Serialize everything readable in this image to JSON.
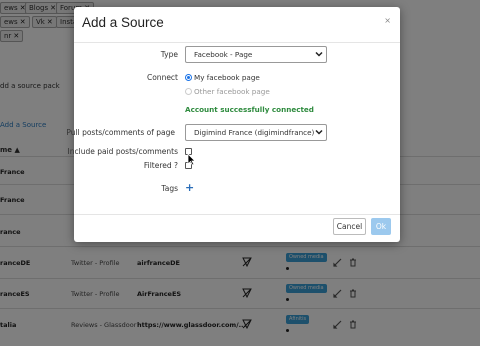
{
  "background": {
    "tags": [
      {
        "label": "ews",
        "x": 0,
        "y": 2
      },
      {
        "label": "Blogs",
        "x": 25,
        "y": 2
      },
      {
        "label": "Forum",
        "x": 56,
        "y": 2
      },
      {
        "label": "ews",
        "x": 0,
        "y": 16
      },
      {
        "label": "Vk",
        "x": 32,
        "y": 16
      },
      {
        "label": "Insta",
        "x": 56,
        "y": 16
      },
      {
        "label": "nr",
        "x": 0,
        "y": 30
      }
    ],
    "add_source_pack": "dd a source pack",
    "add_source_link": "Add a Source",
    "name_header": "me",
    "rows": [
      {
        "name": "France",
        "type": "",
        "handle": "",
        "badge": ""
      },
      {
        "name": "France",
        "type": "",
        "handle": "",
        "badge": ""
      },
      {
        "name": "rance",
        "type": "",
        "handle": "",
        "badge": ""
      },
      {
        "name": "ranceDE",
        "type": "Twitter - Profile",
        "handle": "airfranceDE",
        "badge": "Owned media"
      },
      {
        "name": "ranceES",
        "type": "Twitter - Profile",
        "handle": "AirFranceES",
        "badge": "Owned media"
      },
      {
        "name": "talia",
        "type": "Reviews - Glassdoor",
        "handle": "https://www.glassdoor.com/...",
        "badge": "Afinitis"
      }
    ]
  },
  "modal": {
    "title": "Add a Source",
    "close_label": "×",
    "type_label": "Type",
    "type_value": "Facebook - Page",
    "connect_label": "Connect",
    "connect_options": [
      {
        "label": "My facebook page",
        "selected": true
      },
      {
        "label": "Other facebook page",
        "selected": false
      }
    ],
    "success_message": "Account successfully connected",
    "pull_label": "Pull posts/comments of page",
    "pull_value": "Digimind France (digimindfrance)",
    "paid_label": "Include paid posts/comments",
    "filtered_label": "Filtered ?",
    "tags_label": "Tags",
    "cancel_label": "Cancel",
    "ok_label": "Ok"
  },
  "colors": {
    "accent": "#1a73e8",
    "success": "#2e8b3e",
    "ok_button": "#9cc9ee",
    "badge": "#3aa0d8"
  }
}
